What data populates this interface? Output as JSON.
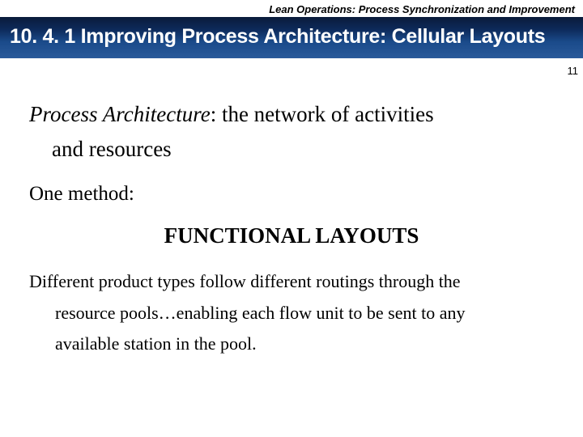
{
  "header": "Lean Operations:  Process Synchronization and Improvement",
  "title": "10. 4. 1  Improving Process Architecture:  Cellular Layouts",
  "page_number": "11",
  "definition_term": "Process Architecture",
  "definition_rest": ":  the network of activities",
  "definition_line2": "and resources",
  "one_method": "One method:",
  "functional_heading": "FUNCTIONAL LAYOUTS",
  "body_line1": "Different product types follow different routings through the",
  "body_line2": "resource pools…enabling each flow unit to be sent to any",
  "body_line3": "available station in the pool."
}
